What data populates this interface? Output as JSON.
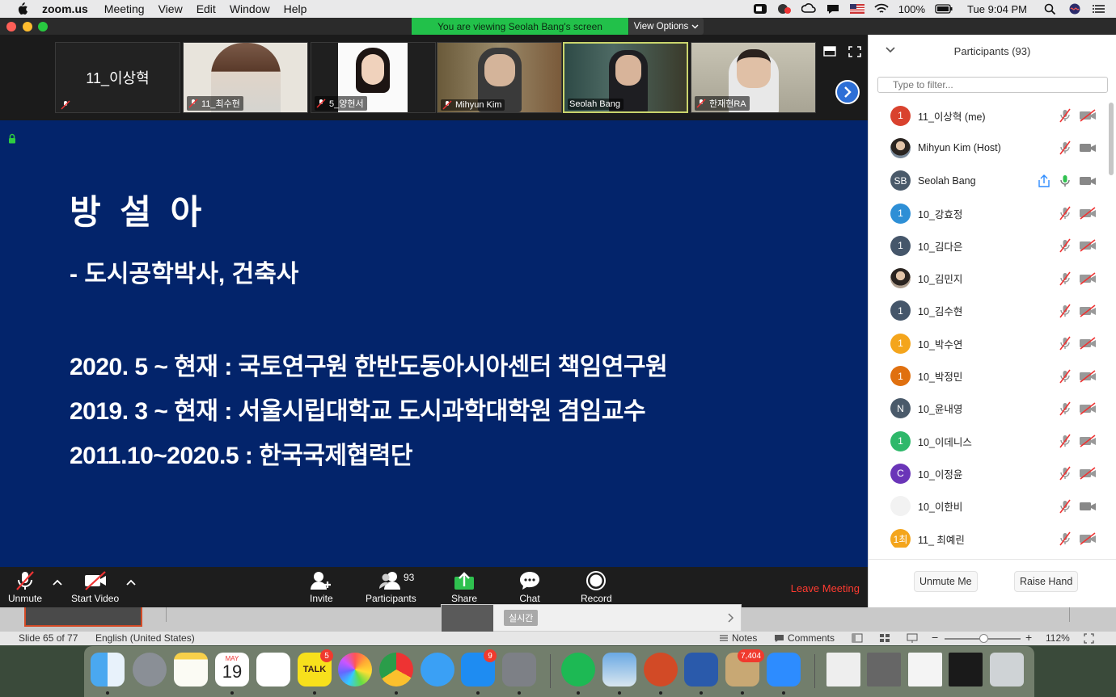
{
  "menubar": {
    "app": "zoom.us",
    "menus": [
      "Meeting",
      "View",
      "Edit",
      "Window",
      "Help"
    ],
    "battery": "100%",
    "clock": "Tue 9:04 PM"
  },
  "window": {
    "viewing_banner": "You are viewing Seolah Bang's screen",
    "view_options": "View Options"
  },
  "video_tiles": [
    {
      "name": "11_이상혁",
      "has_video": false
    },
    {
      "name": "11_최수현",
      "has_video": true
    },
    {
      "name": "5_양현서",
      "has_video": true
    },
    {
      "name": "Mihyun Kim",
      "has_video": true
    },
    {
      "name": "Seolah Bang",
      "has_video": true,
      "active": true
    },
    {
      "name": "한재현RA",
      "has_video": true
    }
  ],
  "slide": {
    "title": "방 설 아",
    "subtitle": "-  도시공학박사, 건축사",
    "lines": [
      "2020. 5 ~ 현재 : 국토연구원   한반도동아시아센터 책임연구원",
      "2019. 3 ~ 현재 : 서울시립대학교 도시과학대학원 겸임교수",
      "2011.10~2020.5 : 한국국제협력단"
    ]
  },
  "toolbar": {
    "unmute": "Unmute",
    "start_video": "Start Video",
    "invite": "Invite",
    "participants": "Participants",
    "participants_count": "93",
    "share": "Share",
    "chat": "Chat",
    "record": "Record",
    "leave": "Leave Meeting"
  },
  "panel": {
    "title": "Participants (93)",
    "filter_placeholder": "Type to filter...",
    "unmute_me": "Unmute Me",
    "raise_hand": "Raise Hand",
    "participants": [
      {
        "initial": "1",
        "name": "11_이상혁 (me)",
        "color": "#d9422e",
        "mic": "muted",
        "cam": "off"
      },
      {
        "initial": "",
        "name": "Mihyun Kim (Host)",
        "color": "#7a8a9a",
        "photo": true,
        "mic": "muted",
        "cam": "on"
      },
      {
        "initial": "SB",
        "name": "Seolah Bang",
        "color": "#4a5a6a",
        "mic": "active",
        "cam": "on",
        "sharing": true
      },
      {
        "initial": "1",
        "name": "10_강효정",
        "color": "#2e8fd6",
        "mic": "muted",
        "cam": "off"
      },
      {
        "initial": "1",
        "name": "10_김다은",
        "color": "#45566a",
        "mic": "muted",
        "cam": "off"
      },
      {
        "initial": "",
        "name": "10_김민지",
        "color": "#b0a090",
        "photo": true,
        "mic": "muted",
        "cam": "off"
      },
      {
        "initial": "1",
        "name": "10_김수현",
        "color": "#45566a",
        "mic": "muted",
        "cam": "off"
      },
      {
        "initial": "1",
        "name": "10_박수연",
        "color": "#f4a51c",
        "mic": "muted",
        "cam": "off"
      },
      {
        "initial": "1",
        "name": "10_박정민",
        "color": "#e0700f",
        "mic": "muted",
        "cam": "off"
      },
      {
        "initial": "N",
        "name": "10_윤내영",
        "color": "#4a5a6a",
        "mic": "muted",
        "cam": "off"
      },
      {
        "initial": "1",
        "name": "10_이데니스",
        "color": "#2eb86a",
        "mic": "muted",
        "cam": "off"
      },
      {
        "initial": "C",
        "name": "10_이정윤",
        "color": "#6a35b8",
        "mic": "muted",
        "cam": "off"
      },
      {
        "initial": "",
        "name": "10_이한비",
        "color": "#f2f2f2",
        "mic": "muted",
        "cam": "on"
      },
      {
        "initial": "1최",
        "name": "11_ 최예린",
        "color": "#f4a51c",
        "mic": "muted",
        "cam": "off"
      }
    ]
  },
  "powerpoint": {
    "chat_tag": "실시간",
    "slide_counter": "Slide 65 of 77",
    "language": "English (United States)",
    "notes": "Notes",
    "comments": "Comments",
    "zoom_level": "112%"
  },
  "dock": {
    "badges": {
      "kakaotalk": "5",
      "appstore": "9",
      "mail": "7,404"
    },
    "calendar_month": "MAY",
    "calendar_day": "19",
    "kakaotalk_label": "TALK"
  }
}
